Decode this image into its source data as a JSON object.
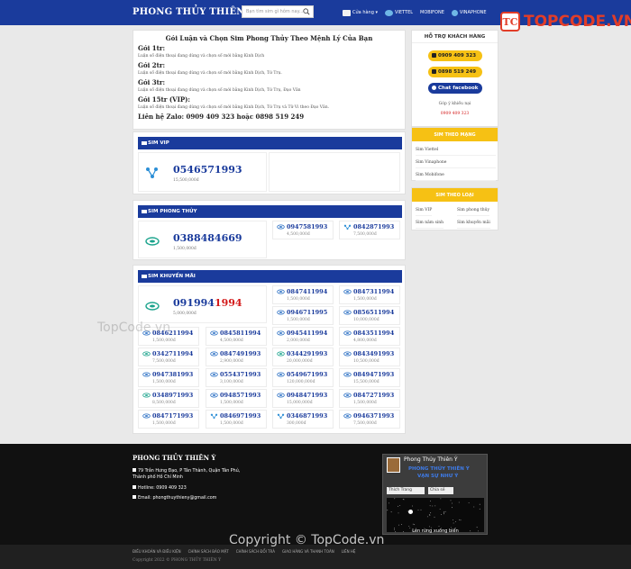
{
  "header": {
    "brand": "PHONG THỦY THIÊN Ý",
    "search_placeholder": "Bạn tìm sim gì hôm nay...",
    "nav": [
      {
        "label": "Cửa hàng ▾",
        "icon": "store-icon"
      },
      {
        "label": "VIETTEL",
        "icon": "viettel-icon"
      },
      {
        "label": "MOBIFONE",
        "icon": "mobifone-icon"
      },
      {
        "label": "VINAPHONE",
        "icon": "vinaphone-icon"
      }
    ]
  },
  "watermark": {
    "logo_text": "TOPCODE.VN",
    "mid": "TopCode.vn",
    "bottom": "Copyright © TopCode.vn"
  },
  "intro": {
    "title": "Gói Luận và Chọn Sim Phong Thủy Theo Mệnh Lý Của Bạn",
    "packages": [
      {
        "name": "Gói 1tr:",
        "desc": "Luận số điện thoại đang dùng và chọn số mới bằng Kinh Dịch"
      },
      {
        "name": "Gói 2tr:",
        "desc": "Luận số điện thoại đang dùng và chọn số mới bằng Kinh Dịch, Tứ Trụ."
      },
      {
        "name": "Gói 3tr:",
        "desc": "Luận số điện thoại đang dùng và chọn số mới bằng Kinh Dịch, Tứ Trụ, Đạo Văn"
      },
      {
        "name": "Gói 15tr (VIP):",
        "desc": "Luận số điện thoại đang dùng và chọn số mới bằng Kinh Dịch, Tứ Trụ và Tử Vi theo Đạo Văn."
      }
    ],
    "contact": "Liên hệ Zalo: 0909 409 323 hoặc 0898 519 249"
  },
  "sections": {
    "vip": {
      "title": "SIM VIP",
      "featured": {
        "number": "0546571993",
        "price": "15,500,000đ",
        "carrier": "vinaphone"
      }
    },
    "phongthuy": {
      "title": "SIM PHONG THỦY",
      "featured": {
        "number": "0388484669",
        "price": "1,500,000đ",
        "carrier": "viettel"
      },
      "items": [
        {
          "number": "0947581993",
          "price": "4,500,000đ",
          "carrier": "mobifone"
        },
        {
          "number": "0842871993",
          "price": "7,500,000đ",
          "carrier": "vinaphone"
        }
      ]
    },
    "khuyenmai": {
      "title": "SIM KHUYẾN MÃI",
      "featured": {
        "number_main": "091994",
        "number_hl": "1994",
        "price": "5,000,000đ",
        "carrier": "viettel"
      },
      "items": [
        {
          "number": "0847411994",
          "price": "1,500,000đ",
          "carrier": "mobifone"
        },
        {
          "number": "0847311994",
          "price": "1,500,000đ",
          "carrier": "mobifone"
        },
        {
          "number": "0946711995",
          "price": "1,500,000đ",
          "carrier": "mobifone"
        },
        {
          "number": "0856511994",
          "price": "10,000,000đ",
          "carrier": "mobifone"
        },
        {
          "number": "0846211994",
          "price": "1,500,000đ",
          "carrier": "mobifone"
        },
        {
          "number": "0845811994",
          "price": "4,500,000đ",
          "carrier": "mobifone"
        },
        {
          "number": "0945411994",
          "price": "2,000,000đ",
          "carrier": "mobifone"
        },
        {
          "number": "0843511994",
          "price": "4,800,000đ",
          "carrier": "mobifone"
        },
        {
          "number": "0342711994",
          "price": "7,500,000đ",
          "carrier": "viettel"
        },
        {
          "number": "0847491993",
          "price": "2,900,000đ",
          "carrier": "mobifone"
        },
        {
          "number": "0344291993",
          "price": "20,000,000đ",
          "carrier": "viettel"
        },
        {
          "number": "0843491993",
          "price": "10,500,000đ",
          "carrier": "mobifone"
        },
        {
          "number": "0947381993",
          "price": "1,500,000đ",
          "carrier": "mobifone"
        },
        {
          "number": "0554371993",
          "price": "3,100,000đ",
          "carrier": "mobifone"
        },
        {
          "number": "0549671993",
          "price": "120,000,000đ",
          "carrier": "mobifone"
        },
        {
          "number": "0849471993",
          "price": "15,500,000đ",
          "carrier": "mobifone"
        },
        {
          "number": "0348971993",
          "price": "8,500,000đ",
          "carrier": "viettel"
        },
        {
          "number": "0948571993",
          "price": "1,500,000đ",
          "carrier": "mobifone"
        },
        {
          "number": "0948471993",
          "price": "15,000,000đ",
          "carrier": "mobifone"
        },
        {
          "number": "0847271993",
          "price": "1,500,000đ",
          "carrier": "mobifone"
        },
        {
          "number": "0847171993",
          "price": "1,500,000đ",
          "carrier": "mobifone"
        },
        {
          "number": "0846971993",
          "price": "1,500,000đ",
          "carrier": "vinaphone"
        },
        {
          "number": "0346871993",
          "price": "300,000đ",
          "carrier": "vinaphone"
        },
        {
          "number": "0946371993",
          "price": "7,500,000đ",
          "carrier": "mobifone"
        }
      ]
    }
  },
  "sidebar": {
    "support": {
      "title": "HỖ TRỢ KHÁCH HÀNG",
      "phone1": "0909 409 323",
      "phone2": "0898 519 249",
      "facebook": "Chat facebook",
      "note": "Góp ý khiếu nại",
      "note_phone": "0909 409 323"
    },
    "by_network": {
      "title": "SIM THEO MẠNG",
      "links": [
        "Sim Viettel",
        "Sim Vinaphone",
        "Sim Mobifone"
      ]
    },
    "by_type": {
      "title": "SIM THEO LOẠI",
      "links": [
        "Sim VIP",
        "Sim phong thủy",
        "Sim năm sinh",
        "Sim khuyến mãi"
      ]
    }
  },
  "footer": {
    "title": "PHONG THỦY THIÊN Ý",
    "address": "79 Trần Hưng Đạo, P Tân Thành, Quận Tân Phú,",
    "city": "Thành phố Hồ Chí Minh",
    "hotline": "Hotline: 0909 409 323",
    "email": "Email: phongthuythieny@gmail.com",
    "fb_page_name": "Phong Thủy Thiên Ý",
    "fb_banner_1": "PHONG THỦY THIÊN Ý",
    "fb_banner_2": "VẠN SỰ NHƯ Ý",
    "fb_follow": "Thích Trang",
    "fb_share": "Chia sẻ",
    "fb_caption": "Lên rừng xuống biển",
    "links": [
      "ĐIỀU KHOẢN VÀ ĐIỀU KIỆN",
      "CHÍNH SÁCH BẢO MẬT",
      "CHÍNH SÁCH ĐỔI TRẢ",
      "GIAO HÀNG VÀ THANH TOÁN",
      "LIÊN HỆ"
    ],
    "copyright": "Copyright 2022 © PHONG THỦY THIÊN Ý"
  },
  "colors": {
    "primary": "#1a3b9c",
    "accent": "#f6c114",
    "highlight": "#d31a1a"
  }
}
